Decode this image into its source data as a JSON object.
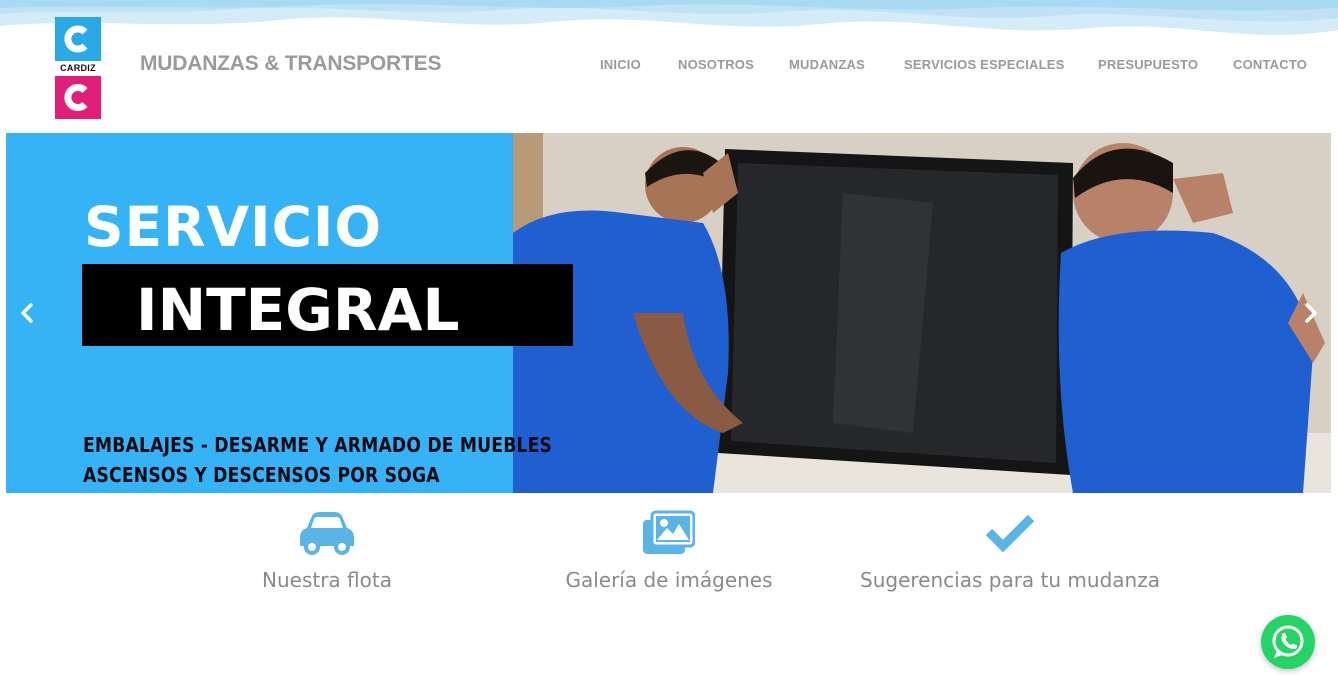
{
  "header": {
    "logo_text": "CARDIZ",
    "brand": "MUDANZAS & TRANSPORTES",
    "nav": [
      "INICIO",
      "NOSOTROS",
      "MUDANZAS",
      "SERVICIOS ESPECIALES",
      "PRESUPUESTO",
      "CONTACTO"
    ]
  },
  "slider": {
    "heading_line1": "SERVICIO",
    "heading_line2": "INTEGRAL",
    "subtext_line1": "EMBALAJES - DESARME Y ARMADO DE MUEBLES",
    "subtext_line2": "ASCENSOS Y DESCENSOS POR SOGA",
    "panel_color": "#36b3f7",
    "icons": {
      "prev": "chevron-left-icon",
      "next": "chevron-right-icon"
    }
  },
  "features": [
    {
      "label": "Nuestra flota",
      "icon": "car-icon"
    },
    {
      "label": "Galería de imágenes",
      "icon": "images-icon"
    },
    {
      "label": "Sugerencias para tu mudanza",
      "icon": "check-icon"
    }
  ],
  "colors": {
    "accent_blue": "#5ab4e5",
    "logo_blue": "#29a9e6",
    "logo_pink": "#e21f78",
    "whatsapp_green": "#25d366",
    "nav_gray": "#9a9a9a"
  },
  "whatsapp": {
    "icon": "whatsapp-icon"
  }
}
